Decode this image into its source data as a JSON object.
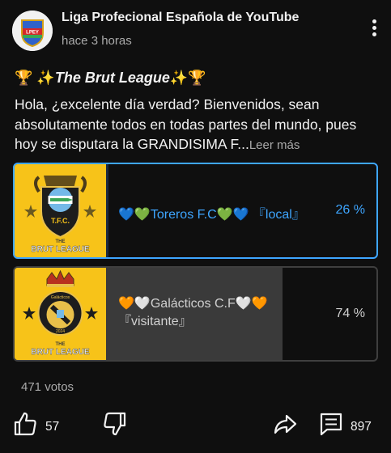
{
  "header": {
    "channel_name": "Liga Profecional Española de YouTube",
    "timestamp": "hace 3 horas",
    "avatar_text": "LPEY",
    "more_icon": "kebab-menu-icon"
  },
  "post": {
    "title_emoji_left": "🏆 ✨",
    "title": "The Brut League",
    "title_emoji_right": "✨🏆",
    "body": "Hola, ¿excelente día verdad? Bienvenidos, sean absolutamente todos en todas partes del mundo, pues hoy se disputara la GRANDISIMA F...",
    "read_more": "Leer más"
  },
  "poll": {
    "options": [
      {
        "label": "💙💚Toreros F.C💚💙 『local』",
        "percent_text": "26 %",
        "percent": 26,
        "selected": true,
        "crest_text": "T.F.C.",
        "banner_small": "THE",
        "banner": "BRUT LEAGUE"
      },
      {
        "label": "🧡🤍Galácticos C.F🤍🧡 『visitante』",
        "percent_text": "74 %",
        "percent": 74,
        "selected": false,
        "crest_text": "Galácticos",
        "crest_year": "2024",
        "banner_small": "THE",
        "banner": "BRUT LEAGUE"
      }
    ],
    "votes": "471 votos"
  },
  "actions": {
    "like_count": "57",
    "comment_count": "897"
  },
  "colors": {
    "background": "#0f0f0f",
    "selected_accent": "#3ea6ff",
    "thumbnail_yellow": "#f7c319"
  }
}
